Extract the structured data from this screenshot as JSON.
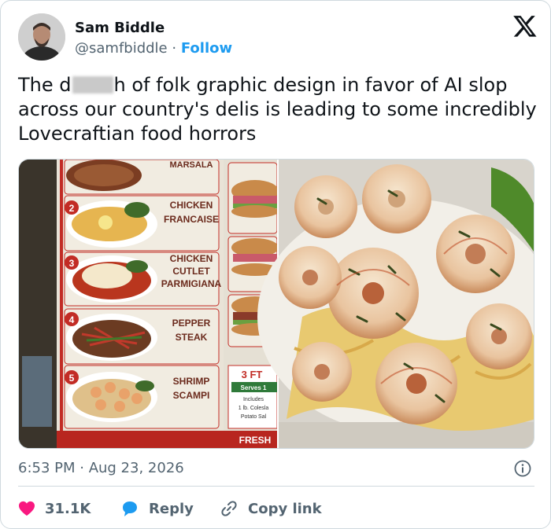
{
  "author": {
    "name": "Sam Biddle",
    "handle": "@samfbiddle",
    "separator": "·",
    "follow_label": "Follow"
  },
  "tweet": {
    "text_before_redaction": "The d",
    "text_after_redaction": "h of folk graphic design in favor of AI slop across our country's delis is leading to some incredibly Lovecraftian food horrors"
  },
  "media": {
    "left_menu": {
      "items": [
        {
          "number": "",
          "name": "MARSALA"
        },
        {
          "number": "2",
          "name": "CHICKEN FRANCAISE"
        },
        {
          "number": "3",
          "name": "CHICKEN CUTLET PARMIGIANA"
        },
        {
          "number": "4",
          "name": "PEPPER STEAK"
        },
        {
          "number": "5",
          "name": "SHRIMP SCAMPI"
        }
      ],
      "price_box": {
        "title": "3 FT",
        "serves": "Serves 1",
        "includes": "Includes",
        "side1": "1 lb. Colesla",
        "side2": "Potato Sal"
      },
      "banner": "FRESH"
    }
  },
  "meta": {
    "timestamp": "6:53 PM · Aug 23, 2026"
  },
  "actions": {
    "like_count": "31.1K",
    "reply_label": "Reply",
    "copy_label": "Copy link"
  },
  "colors": {
    "follow": "#1d9bf0",
    "like": "#f91880",
    "reply": "#1d9bf0",
    "muted": "#536471"
  }
}
